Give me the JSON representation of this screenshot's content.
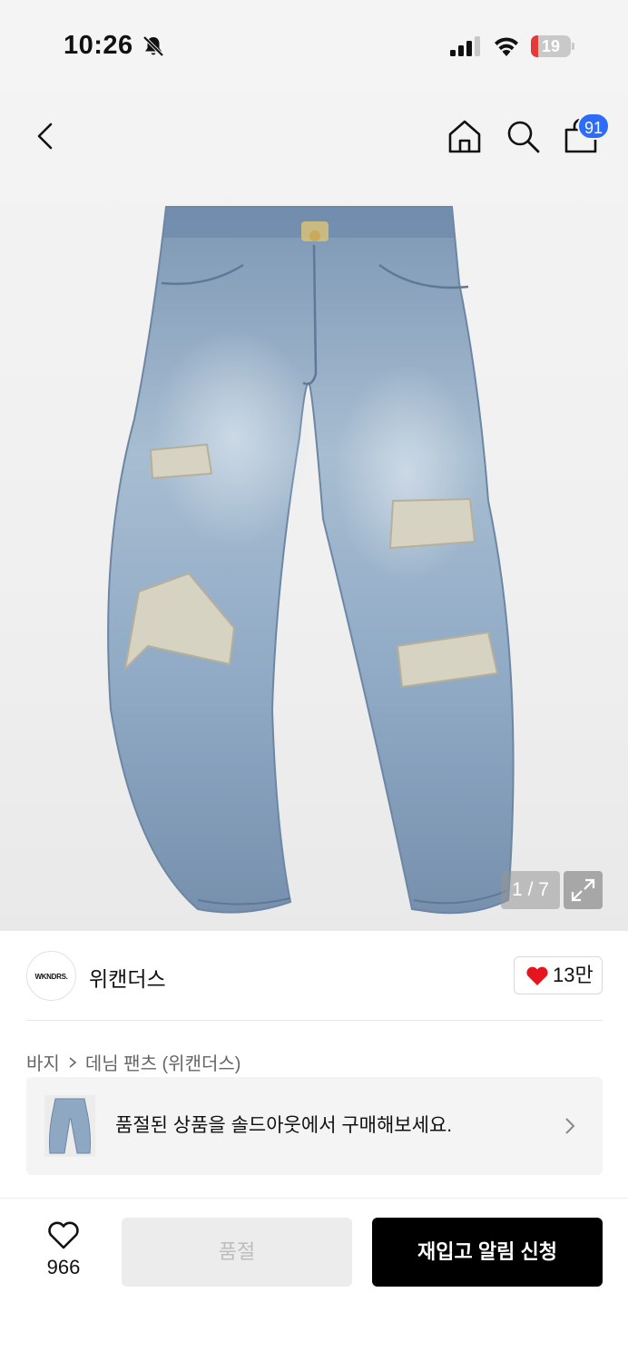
{
  "status_bar": {
    "time": "10:26",
    "battery_percent": "19",
    "battery_level": 0.19
  },
  "header": {
    "cart_count": "91",
    "icons": [
      "back-icon",
      "home-icon",
      "search-icon",
      "shopping-bag-icon"
    ]
  },
  "gallery": {
    "counter": "1 / 7",
    "current": 1,
    "total": 7
  },
  "brand": {
    "logo_text": "WKNDRS.",
    "name": "위캔더스",
    "likes": "13만"
  },
  "breadcrumb": {
    "category": "바지",
    "subcategory": "데님 팬츠 (위캔더스)"
  },
  "soldout_banner": {
    "text": "품절된 상품을 솔드아웃에서 구매해보세요."
  },
  "bottom_bar": {
    "wish_count": "966",
    "soldout_label": "품절",
    "restock_label": "재입고 알림 신청"
  },
  "colors": {
    "accent_blue": "#2d6cf6",
    "heart_red": "#e6141e",
    "battery_red": "#e33a3a"
  }
}
